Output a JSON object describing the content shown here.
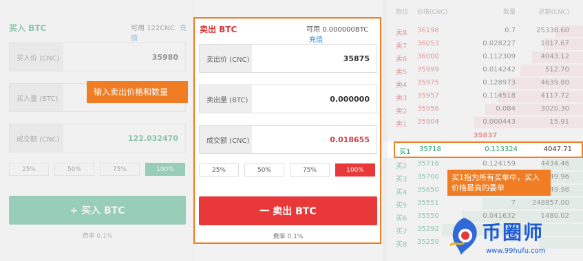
{
  "buy": {
    "title": "买入 BTC",
    "avail_label": "可用",
    "avail_value": "122CNC",
    "recharge": "充值",
    "price_label": "买入价 (CNC)",
    "price_value": "35980",
    "qty_label": "买入量 (BTC)",
    "qty_value": "",
    "total_label": "成交额 (CNC)",
    "total_value": "122.032470",
    "pcts": [
      "25%",
      "50%",
      "75%",
      "100%"
    ],
    "button": "+ 买入 BTC",
    "fee": "费率 0.1%"
  },
  "sell": {
    "title": "卖出 BTC",
    "avail_label": "可用",
    "avail_value": "0.000000BTC",
    "recharge": "充值",
    "price_label": "卖出价 (CNC)",
    "price_value": "35875",
    "qty_label": "卖出量 (BTC)",
    "qty_value": "0.000000",
    "total_label": "成交额 (CNC)",
    "total_value": "0.018655",
    "pcts": [
      "25%",
      "50%",
      "75%",
      "100%"
    ],
    "button": "一 卖出 BTC",
    "fee": "费率 0.1%"
  },
  "book": {
    "headers": [
      "档位",
      "价格(CNC)",
      "数量",
      "总额(CNC)"
    ],
    "asks": [
      {
        "level": "卖8",
        "price": "36198",
        "qty": "0.7",
        "total": "25338.60"
      },
      {
        "level": "卖7",
        "price": "36053",
        "qty": "0.028227",
        "total": "1017.67"
      },
      {
        "level": "卖6",
        "price": "36000",
        "qty": "0.112309",
        "total": "4043.12"
      },
      {
        "level": "卖5",
        "price": "35999",
        "qty": "0.014242",
        "total": "512.70"
      },
      {
        "level": "卖4",
        "price": "35975",
        "qty": "0.128973",
        "total": "4639.80"
      },
      {
        "level": "卖3",
        "price": "35957",
        "qty": "0.114518",
        "total": "4117.72"
      },
      {
        "level": "卖2",
        "price": "35956",
        "qty": "0.084",
        "total": "3020.30"
      },
      {
        "level": "卖1",
        "price": "35904",
        "qty": "0.000443",
        "total": "15.91"
      }
    ],
    "mid_price": "35837",
    "best_bid": {
      "level": "买1",
      "price": "35718",
      "qty": "0.113324",
      "total": "4047.71"
    },
    "bids": [
      {
        "level": "买2",
        "price": "35716",
        "qty": "0.124159",
        "total": "4434.46"
      },
      {
        "level": "买3",
        "price": "35700",
        "qty": "",
        "total": "49.96"
      },
      {
        "level": "买4",
        "price": "35650",
        "qty": "",
        "total": "49.98"
      },
      {
        "level": "买5",
        "price": "35551",
        "qty": "7",
        "total": "248857.00"
      },
      {
        "level": "买6",
        "price": "35550",
        "qty": "0.041632",
        "total": "1480.02"
      },
      {
        "level": "买7",
        "price": "35292",
        "qty": "",
        "total": ""
      },
      {
        "level": "买8",
        "price": "35250",
        "qty": "",
        "total": ""
      }
    ]
  },
  "callouts": {
    "sell_input": "输入卖出价格和数量",
    "bid_note": "买1指为所有买单中，买入价格最高的委单"
  },
  "watermark": {
    "brand": "币圈师",
    "url": "www.99hufu.com"
  },
  "colors": {
    "accent": "#f07c23",
    "buy": "#3bb083",
    "sell": "#e8383a"
  }
}
